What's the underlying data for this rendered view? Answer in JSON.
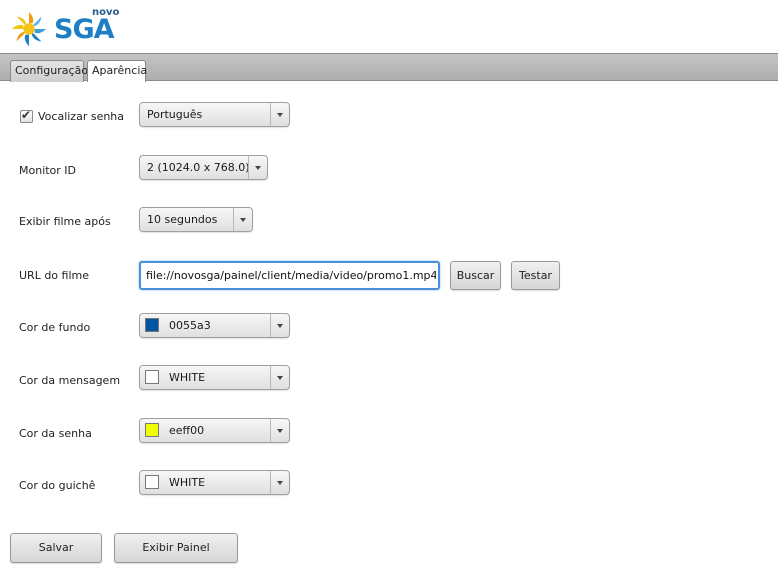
{
  "brand": {
    "small": "novo",
    "name": "SGA"
  },
  "tabs": [
    {
      "label": "Configuração",
      "active": false
    },
    {
      "label": "Aparência",
      "active": true
    }
  ],
  "vocalizar": {
    "label": "Vocalizar senha",
    "checked": true,
    "language": "Português"
  },
  "monitor": {
    "label": "Monitor ID",
    "value": "2 (1024.0 x 768.0)"
  },
  "filme": {
    "label": "Exibir filme após",
    "value": "10 segundos"
  },
  "url": {
    "label": "URL do filme",
    "value": "file://novosga/painel/client/media/video/promo1.mp4",
    "browse": "Buscar",
    "test": "Testar"
  },
  "cor_fundo": {
    "label": "Cor de fundo",
    "value": "0055a3",
    "color": "#0055a3"
  },
  "cor_mensagem": {
    "label": "Cor da mensagem",
    "value": "WHITE",
    "color": "#ffffff"
  },
  "cor_senha": {
    "label": "Cor da senha",
    "value": "eeff00",
    "color": "#eeff00"
  },
  "cor_guiche": {
    "label": "Cor do guichê",
    "value": "WHITE",
    "color": "#ffffff"
  },
  "actions": {
    "save": "Salvar",
    "show_panel": "Exibir Painel"
  }
}
